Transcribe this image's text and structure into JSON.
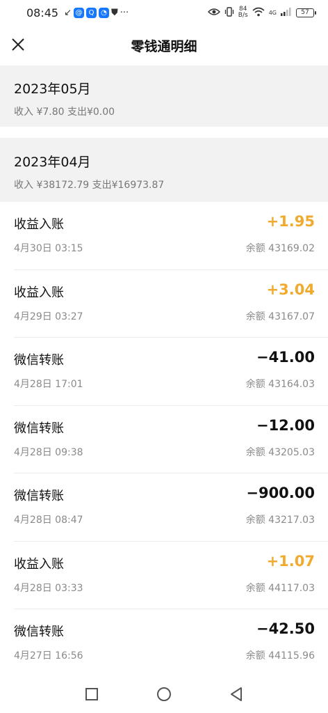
{
  "status_bar": {
    "time": "08:45",
    "net_speed_value": "84",
    "net_speed_unit": "B/s",
    "network": "4G",
    "battery": "57"
  },
  "header": {
    "title": "零钱通明细"
  },
  "months": [
    {
      "title": "2023年05月",
      "summary": "收入 ¥7.80 支出¥0.00"
    },
    {
      "title": "2023年04月",
      "summary": "收入 ¥38172.79 支出¥16973.87"
    }
  ],
  "transactions": [
    {
      "type": "收益入账",
      "datetime": "4月30日 03:15",
      "amount": "+1.95",
      "balance": "余额 43169.02",
      "kind": "income"
    },
    {
      "type": "收益入账",
      "datetime": "4月29日 03:27",
      "amount": "+3.04",
      "balance": "余额 43167.07",
      "kind": "income"
    },
    {
      "type": "微信转账",
      "datetime": "4月28日 17:01",
      "amount": "−41.00",
      "balance": "余额 43164.03",
      "kind": "expense"
    },
    {
      "type": "微信转账",
      "datetime": "4月28日 09:38",
      "amount": "−12.00",
      "balance": "余额 43205.03",
      "kind": "expense"
    },
    {
      "type": "微信转账",
      "datetime": "4月28日 08:47",
      "amount": "−900.00",
      "balance": "余额 43217.03",
      "kind": "expense"
    },
    {
      "type": "收益入账",
      "datetime": "4月28日 03:33",
      "amount": "+1.07",
      "balance": "余额 44117.03",
      "kind": "income"
    },
    {
      "type": "微信转账",
      "datetime": "4月27日 16:56",
      "amount": "−42.50",
      "balance": "余额 44115.96",
      "kind": "expense"
    }
  ],
  "colors": {
    "income": "#f0ab2e",
    "expense": "#111111",
    "section_bg": "#f2f2f2"
  }
}
